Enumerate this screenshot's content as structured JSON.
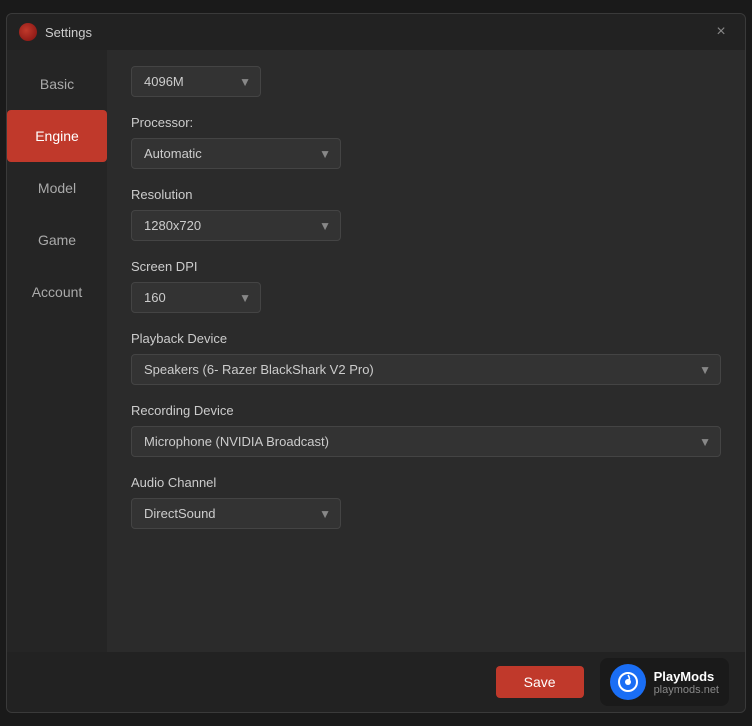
{
  "window": {
    "title": "Settings",
    "close_label": "×"
  },
  "sidebar": {
    "items": [
      {
        "id": "basic",
        "label": "Basic",
        "active": false
      },
      {
        "id": "engine",
        "label": "Engine",
        "active": true
      },
      {
        "id": "model",
        "label": "Model",
        "active": false
      },
      {
        "id": "game",
        "label": "Game",
        "active": false
      },
      {
        "id": "account",
        "label": "Account",
        "active": false
      }
    ]
  },
  "content": {
    "memory_label": "4096M",
    "processor_label": "Processor:",
    "processor_value": "Automatic",
    "resolution_label": "Resolution",
    "resolution_value": "1280x720",
    "screen_dpi_label": "Screen DPI",
    "screen_dpi_value": "160",
    "playback_device_label": "Playback Device",
    "playback_device_value": "Speakers (6- Razer BlackShark V2 Pro)",
    "recording_device_label": "Recording Device",
    "recording_device_value": "Microphone (NVIDIA Broadcast)",
    "audio_channel_label": "Audio Channel",
    "audio_channel_value": "DirectSound"
  },
  "footer": {
    "save_label": "Save",
    "playmods_name": "PlayMods",
    "playmods_url": "playmods.net"
  },
  "icons": {
    "dropdown_arrow": "▼",
    "close": "✕",
    "playmods_symbol": "◎"
  }
}
